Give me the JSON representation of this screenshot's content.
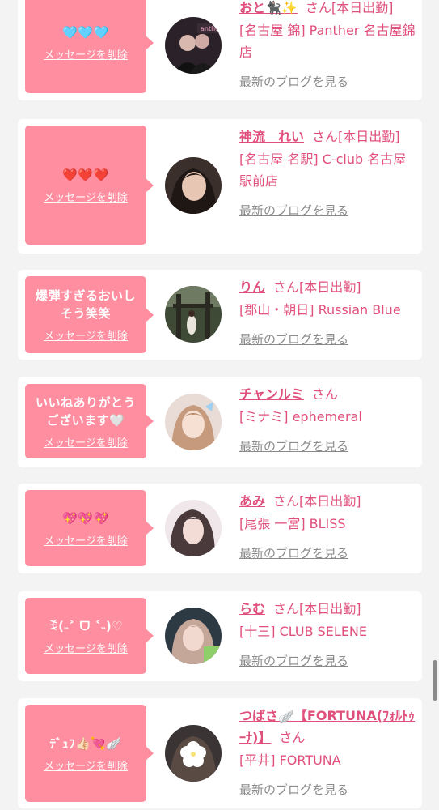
{
  "colors": {
    "page_bg": "#f3f3f3",
    "card_bg": "#ffffff",
    "bubble": "#ff8fa0",
    "accent_pink": "#e0507c",
    "link_gray": "#8a8a8a"
  },
  "cards": [
    {
      "message": "🩵🩵🩵",
      "delete_label": "メッセージを削除",
      "name": "おと🐈‍⬛✨",
      "suffix": "さん[本日出勤]",
      "shop": "[名古屋 錦] Panther 名古屋錦店",
      "blog_label": "最新のブログを見る",
      "avatar_icon": "profile-photo"
    },
    {
      "message": "❤️❤️❤️",
      "delete_label": "メッセージを削除",
      "name": "神流　れい",
      "suffix": "さん[本日出勤]",
      "shop": "[名古屋 名駅] C-club 名古屋駅前店",
      "blog_label": "最新のブログを見る",
      "avatar_icon": "profile-photo"
    },
    {
      "message": "爆弾すぎるおいしそう笑笑",
      "delete_label": "メッセージを削除",
      "name": "りん",
      "suffix": "さん[本日出勤]",
      "shop": "[郡山・朝日] Russian Blue",
      "blog_label": "最新のブログを見る",
      "avatar_icon": "profile-photo"
    },
    {
      "message": "いいねありがとうございます🤍",
      "delete_label": "メッセージを削除",
      "name": "チャンルミ",
      "suffix": "さん",
      "shop": "[ミナミ] ephemeral",
      "blog_label": "最新のブログを見る",
      "avatar_icon": "profile-photo"
    },
    {
      "message": "💖💖💖",
      "delete_label": "メッセージを削除",
      "name": "あみ",
      "suffix": "さん[本日出勤]",
      "shop": "[尾張 一宮] BLISS",
      "blog_label": "最新のブログを見る",
      "avatar_icon": "profile-photo"
    },
    {
      "message": "ꉂ(˵˃ ᗜ ˂˵)♡",
      "delete_label": "メッセージを削除",
      "name": "らむ",
      "suffix": "さん[本日出勤]",
      "shop": "[十三] CLUB SELENE",
      "blog_label": "最新のブログを見る",
      "avatar_icon": "profile-photo"
    },
    {
      "message": "ﾃﾞｭﾌ👍🏻💘🪽",
      "delete_label": "メッセージを削除",
      "name": "つばさ🪽【FORTUNA(ﾌｫﾙﾄｩｰﾅ)】",
      "suffix": "さん",
      "shop": "[平井] FORTUNA",
      "blog_label": "最新のブログを見る",
      "avatar_icon": "profile-photo"
    }
  ]
}
